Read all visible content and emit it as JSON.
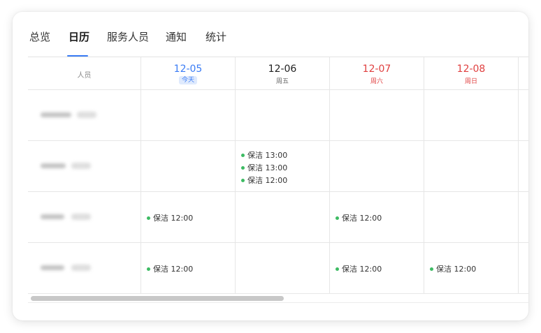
{
  "tabs": [
    {
      "label": "总览",
      "active": false
    },
    {
      "label": "日历",
      "active": true
    },
    {
      "label": "服务人员",
      "active": false
    },
    {
      "label": "通知",
      "active": false
    },
    {
      "label": "统计",
      "active": false
    }
  ],
  "header": {
    "person_column": "人员",
    "days": [
      {
        "date": "12-05",
        "weekday": "今天",
        "today": true,
        "weekend": false
      },
      {
        "date": "12-06",
        "weekday": "周五",
        "today": false,
        "weekend": false
      },
      {
        "date": "12-07",
        "weekday": "周六",
        "today": false,
        "weekend": true
      },
      {
        "date": "12-08",
        "weekday": "周日",
        "today": false,
        "weekend": true
      }
    ]
  },
  "rows": [
    {
      "events": [
        [],
        [],
        [],
        []
      ]
    },
    {
      "events": [
        [],
        [
          "保洁 13:00",
          "保洁 13:00",
          "保洁 12:00"
        ],
        [],
        []
      ]
    },
    {
      "events": [
        [
          "保洁 12:00"
        ],
        [],
        [
          "保洁 12:00"
        ],
        []
      ]
    },
    {
      "events": [
        [
          "保洁 12:00"
        ],
        [],
        [
          "保洁 12:00"
        ],
        [
          "保洁 12:00"
        ]
      ]
    }
  ],
  "colors": {
    "accent": "#3b7cf5",
    "weekend": "#e04040",
    "event_dot": "#3dbb63"
  }
}
